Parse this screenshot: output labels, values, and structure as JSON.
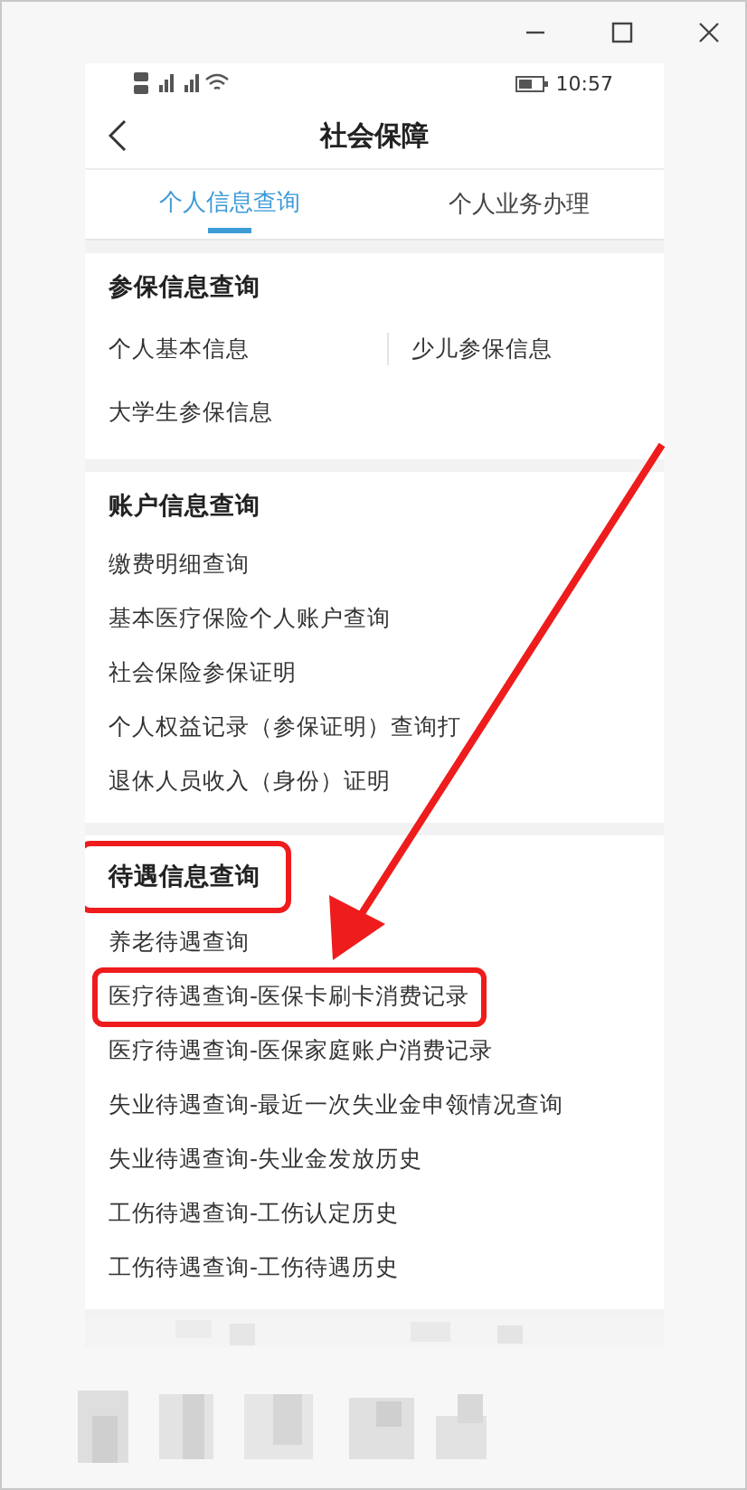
{
  "status_bar": {
    "time": "10:57"
  },
  "header": {
    "title": "社会保障"
  },
  "tabs": [
    {
      "label": "个人信息查询",
      "selected": true
    },
    {
      "label": "个人业务办理",
      "selected": false
    }
  ],
  "sections": [
    {
      "title": "参保信息查询",
      "kind": "grid",
      "highlighted": false,
      "items": [
        {
          "label": "个人基本信息",
          "highlighted": false
        },
        {
          "label": "少儿参保信息",
          "highlighted": false
        },
        {
          "label": "大学生参保信息",
          "highlighted": false
        }
      ]
    },
    {
      "title": "账户信息查询",
      "kind": "list",
      "highlighted": false,
      "items": [
        {
          "label": "缴费明细查询",
          "highlighted": false
        },
        {
          "label": "基本医疗保险个人账户查询",
          "highlighted": false
        },
        {
          "label": "社会保险参保证明",
          "highlighted": false
        },
        {
          "label": "个人权益记录（参保证明）查询打",
          "highlighted": false
        },
        {
          "label": "退休人员收入（身份）证明",
          "highlighted": false
        }
      ]
    },
    {
      "title": "待遇信息查询",
      "kind": "list",
      "highlighted": true,
      "items": [
        {
          "label": "养老待遇查询",
          "highlighted": false
        },
        {
          "label": "医疗待遇查询-医保卡刷卡消费记录",
          "highlighted": true
        },
        {
          "label": "医疗待遇查询-医保家庭账户消费记录",
          "highlighted": false
        },
        {
          "label": "失业待遇查询-最近一次失业金申领情况查询",
          "highlighted": false
        },
        {
          "label": "失业待遇查询-失业金发放历史",
          "highlighted": false
        },
        {
          "label": "工伤待遇查询-工伤认定历史",
          "highlighted": false
        },
        {
          "label": "工伤待遇查询-工伤待遇历史",
          "highlighted": false
        }
      ]
    }
  ],
  "annotation_arrow": true
}
